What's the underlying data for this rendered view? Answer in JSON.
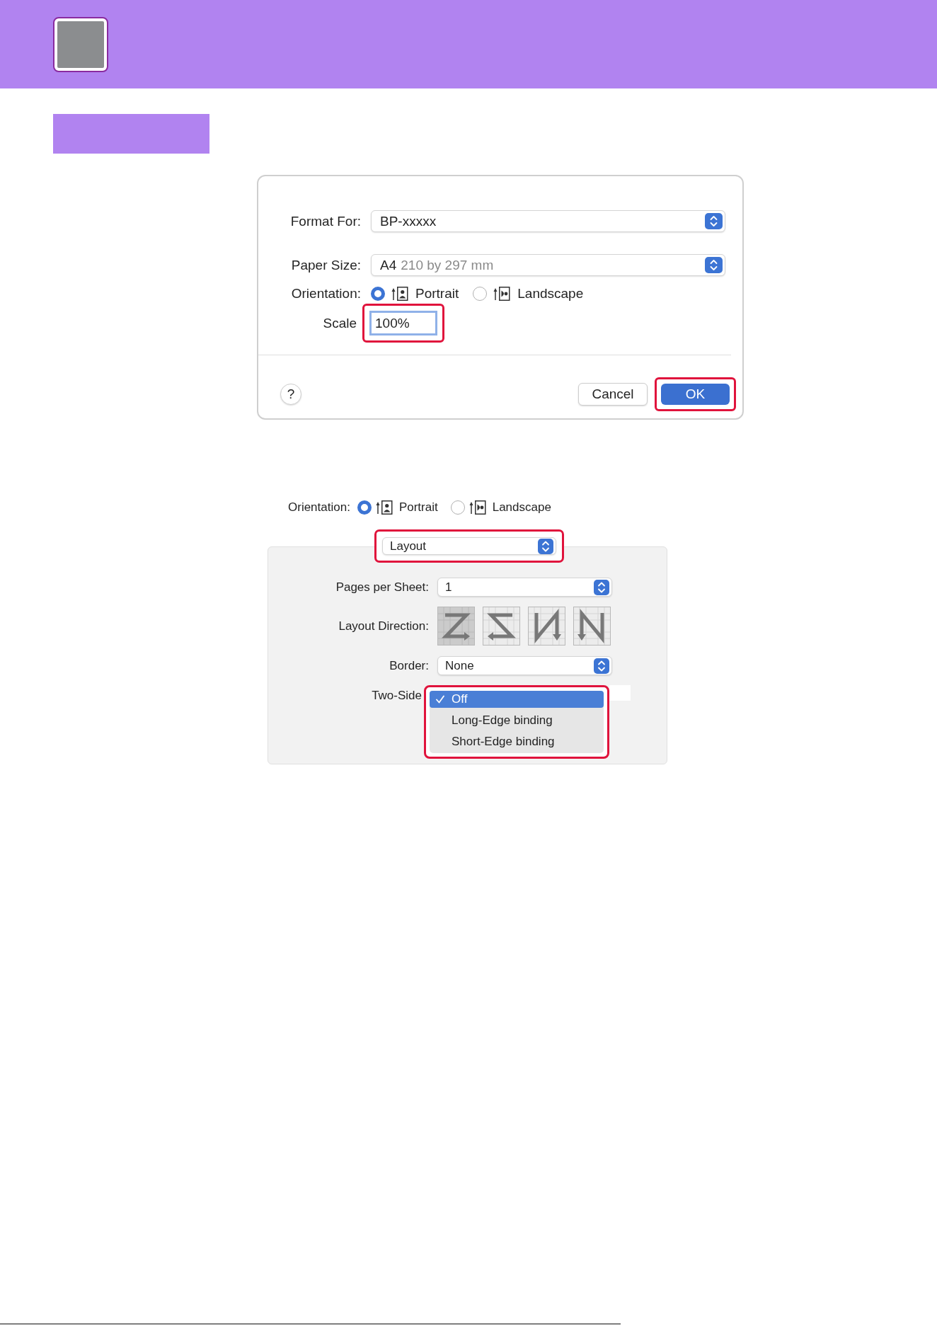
{
  "page_setup": {
    "rows": [
      {
        "kind": "popup",
        "label": "Format For:",
        "value": "BP-xxxxx",
        "highlighted": false
      },
      {
        "kind": "popup",
        "label": "Paper Size:",
        "value": "A4",
        "detail": "210 by 297 mm",
        "highlighted": false
      },
      {
        "kind": "radio",
        "label": "Orientation:",
        "highlighted": false,
        "options": [
          {
            "kind": "portrait",
            "label": "Portrait",
            "selected": true
          },
          {
            "kind": "landscape",
            "label": "Landscape",
            "selected": false
          }
        ]
      },
      {
        "kind": "field",
        "label": "Scale",
        "value": "100%",
        "highlighted": true
      }
    ],
    "help_button": {
      "label": "?"
    },
    "buttons": [
      {
        "kind": "normal",
        "label": "Cancel",
        "highlighted": false
      },
      {
        "kind": "default",
        "label": "OK",
        "highlighted": true
      }
    ]
  },
  "print_dialog": {
    "orientation": {
      "label": "Orientation:",
      "options": [
        {
          "kind": "portrait",
          "label": "Portrait",
          "selected": true
        },
        {
          "kind": "landscape",
          "label": "Landscape",
          "selected": false
        }
      ]
    },
    "panel_menu": {
      "value": "Layout",
      "highlighted": true
    },
    "rows": [
      {
        "kind": "popup",
        "label": "Pages per Sheet:",
        "value": "1",
        "highlighted": false
      },
      {
        "kind": "directions",
        "label": "Layout Direction:",
        "highlighted": false,
        "options": [
          {
            "kind": "z",
            "selected": true
          },
          {
            "kind": "zreverse",
            "selected": false
          },
          {
            "kind": "nreverse",
            "selected": false
          },
          {
            "kind": "n",
            "selected": false
          }
        ]
      },
      {
        "kind": "popup",
        "label": "Border:",
        "value": "None",
        "highlighted": false
      },
      {
        "kind": "menu",
        "label": "Two-Side",
        "highlighted": true,
        "items": [
          {
            "label": "Off",
            "selected": true
          },
          {
            "label": "Long-Edge binding",
            "selected": false
          },
          {
            "label": "Short-Edge binding",
            "selected": false
          }
        ]
      }
    ]
  }
}
